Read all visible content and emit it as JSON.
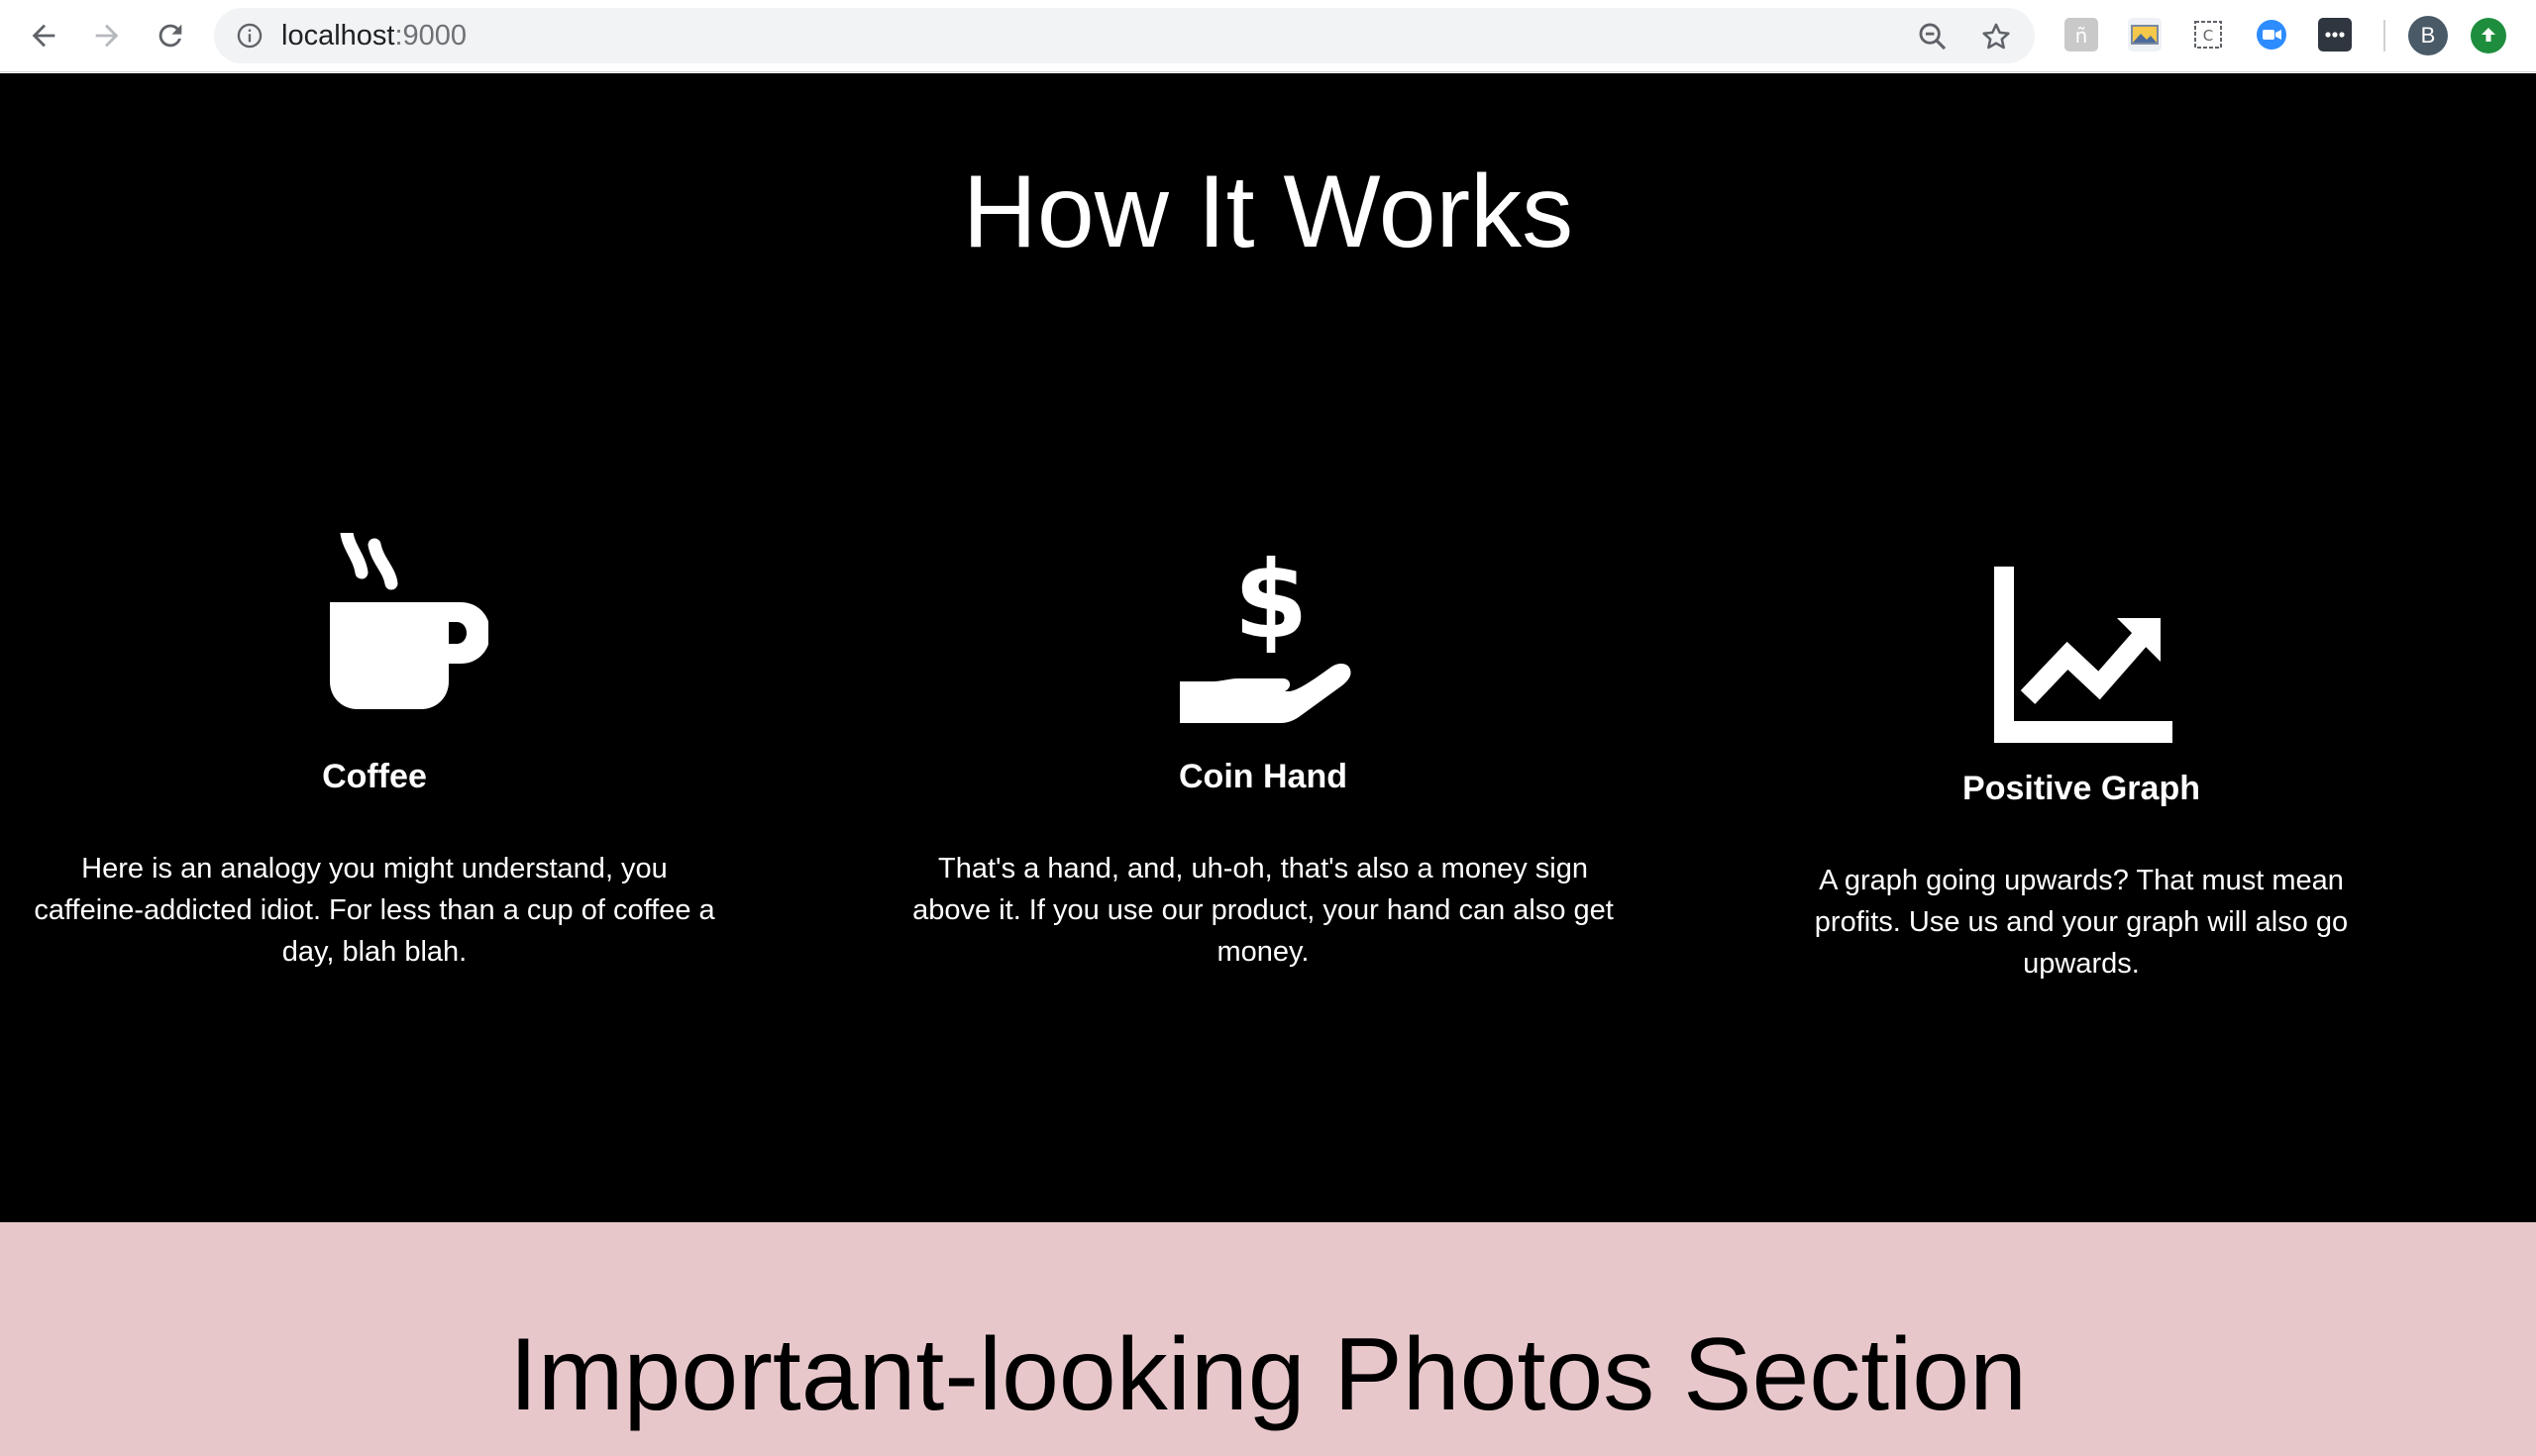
{
  "browser": {
    "url_host": "localhost",
    "url_port": ":9000",
    "profile_initial": "B",
    "extensions": [
      "ext-icon-1",
      "ext-icon-2",
      "ext-icon-3",
      "zoom-icon",
      "ext-icon-5"
    ],
    "colors": {
      "omnibox": "#f1f3f4",
      "avatar": "#4a5a67",
      "update": "#1e8e3e"
    }
  },
  "how_it_works": {
    "title": "How It Works",
    "features": [
      {
        "icon": "coffee-icon",
        "title": "Coffee",
        "text": "Here is an analogy you might understand, you caffeine-addicted idiot. For less than a cup of coffee a day, blah blah."
      },
      {
        "icon": "coin-hand-icon",
        "title": "Coin Hand",
        "text": "That's a hand, and, uh-oh, that's also a money sign above it. If you use our product, your hand can also get money."
      },
      {
        "icon": "positive-graph-icon",
        "title": "Positive Graph",
        "text": "A graph going upwards? That must mean profits. Use us and your graph will also go upwards."
      }
    ]
  },
  "photos_section": {
    "title": "Important-looking Photos Section",
    "background": "#e8c7cb"
  }
}
